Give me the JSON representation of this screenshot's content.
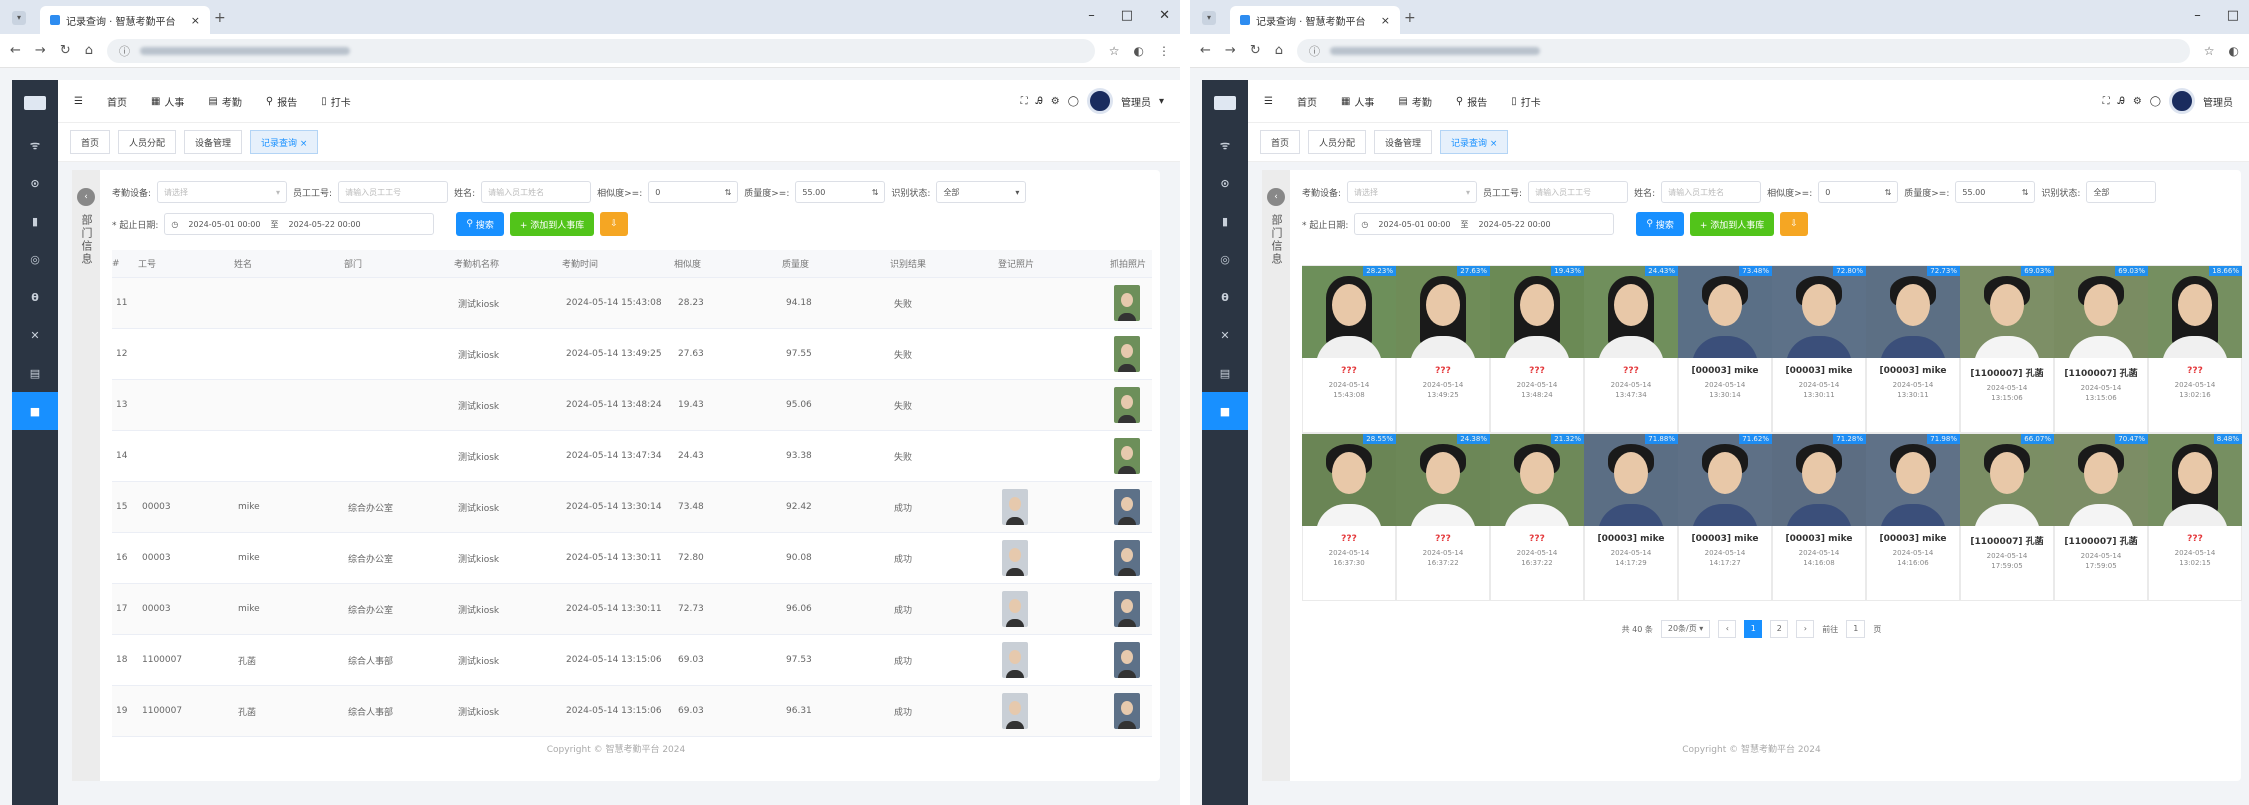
{
  "browser": {
    "tab_title": "记录查询 · 智慧考勤平台",
    "tab_close": "×",
    "new_tab": "+",
    "window_controls": [
      "–",
      "□",
      "✕"
    ]
  },
  "app": {
    "top_menu": [
      {
        "label": "首页",
        "icon": "home-icon"
      },
      {
        "label": "人事",
        "icon": "grid-icon"
      },
      {
        "label": "考勤",
        "icon": "calendar-icon"
      },
      {
        "label": "报告",
        "icon": "search-icon"
      },
      {
        "label": "打卡",
        "icon": "doc-icon"
      }
    ],
    "user_name": "管理员",
    "tags": [
      {
        "label": "首页"
      },
      {
        "label": "人员分配"
      },
      {
        "label": "设备管理"
      },
      {
        "label": "记录查询 ×",
        "active": true
      }
    ],
    "sidebar_glyphs": [
      "ᯤ",
      "⊙",
      "▮",
      "◎",
      "θ",
      "✕",
      "▤",
      "■"
    ],
    "dept_panel": {
      "toggle": "‹",
      "label": "部门信息"
    },
    "copyright": "Copyright © 智慧考勤平台 2024"
  },
  "left_window": {
    "filters": {
      "device_label": "考勤设备:",
      "device_placeholder": "请选择",
      "emp_id_label": "员工工号:",
      "emp_id_placeholder": "请输入员工工号",
      "name_label": "姓名:",
      "name_placeholder": "请输入员工姓名",
      "similarity_label": "相似度>=:",
      "similarity_value": "0",
      "quality_label": "质量度>=:",
      "quality_value": "55.00",
      "status_label": "识别状态:",
      "status_value": "全部",
      "date_label": "* 起止日期:",
      "date_start": "2024-05-01 00:00",
      "date_sep": "至",
      "date_end": "2024-05-22 00:00",
      "btn_search": "搜索",
      "btn_add": "+ 添加到人事库",
      "btn_export": "⇩"
    },
    "columns": [
      "#",
      "工号",
      "姓名",
      "部门",
      "考勤机名称",
      "考勤时间",
      "相似度",
      "质量度",
      "识别结果",
      "登记照片",
      "抓拍照片"
    ],
    "rows": [
      {
        "no": "11",
        "id": "",
        "name": "",
        "dept": "",
        "device": "测试kiosk",
        "time": "2024-05-14 15:43:08",
        "sim": "28.23",
        "qual": "94.18",
        "result": "失败",
        "reg": false
      },
      {
        "no": "12",
        "id": "",
        "name": "",
        "dept": "",
        "device": "测试kiosk",
        "time": "2024-05-14 13:49:25",
        "sim": "27.63",
        "qual": "97.55",
        "result": "失败",
        "reg": false
      },
      {
        "no": "13",
        "id": "",
        "name": "",
        "dept": "",
        "device": "测试kiosk",
        "time": "2024-05-14 13:48:24",
        "sim": "19.43",
        "qual": "95.06",
        "result": "失败",
        "reg": false
      },
      {
        "no": "14",
        "id": "",
        "name": "",
        "dept": "",
        "device": "测试kiosk",
        "time": "2024-05-14 13:47:34",
        "sim": "24.43",
        "qual": "93.38",
        "result": "失败",
        "reg": false
      },
      {
        "no": "15",
        "id": "00003",
        "name": "mike",
        "dept": "综合办公室",
        "device": "测试kiosk",
        "time": "2024-05-14 13:30:14",
        "sim": "73.48",
        "qual": "92.42",
        "result": "成功",
        "reg": true
      },
      {
        "no": "16",
        "id": "00003",
        "name": "mike",
        "dept": "综合办公室",
        "device": "测试kiosk",
        "time": "2024-05-14 13:30:11",
        "sim": "72.80",
        "qual": "90.08",
        "result": "成功",
        "reg": true
      },
      {
        "no": "17",
        "id": "00003",
        "name": "mike",
        "dept": "综合办公室",
        "device": "测试kiosk",
        "time": "2024-05-14 13:30:11",
        "sim": "72.73",
        "qual": "96.06",
        "result": "成功",
        "reg": true
      },
      {
        "no": "18",
        "id": "1100007",
        "name": "孔菡",
        "dept": "综合人事部",
        "device": "测试kiosk",
        "time": "2024-05-14 13:15:06",
        "sim": "69.03",
        "qual": "97.53",
        "result": "成功",
        "reg": true
      },
      {
        "no": "19",
        "id": "1100007",
        "name": "孔菡",
        "dept": "综合人事部",
        "device": "测试kiosk",
        "time": "2024-05-14 13:15:06",
        "sim": "69.03",
        "qual": "96.31",
        "result": "成功",
        "reg": true
      }
    ]
  },
  "right_window": {
    "filters": {
      "device_label": "考勤设备:",
      "device_placeholder": "请选择",
      "emp_id_label": "员工工号:",
      "emp_id_placeholder": "请输入员工工号",
      "name_label": "姓名:",
      "name_placeholder": "请输入员工姓名",
      "similarity_label": "相似度>=:",
      "similarity_value": "0",
      "quality_label": "质量度>=:",
      "quality_value": "55.00",
      "status_label": "识别状态:",
      "status_value": "全部",
      "date_label": "* 起止日期:",
      "date_start": "2024-05-01 00:00",
      "date_sep": "至",
      "date_end": "2024-05-22 00:00",
      "btn_search": "搜索",
      "btn_add": "+ 添加到人事库",
      "btn_export": "⇩"
    },
    "cards": [
      {
        "score": "28.23%",
        "name": "???",
        "date": "2024-05-14",
        "time": "15:43:08",
        "known": false,
        "gender": "f",
        "bg": "#6d8f5a",
        "shirt": "#f0f0f0"
      },
      {
        "score": "27.63%",
        "name": "???",
        "date": "2024-05-14",
        "time": "13:49:25",
        "known": false,
        "gender": "f",
        "bg": "#6f8c58",
        "shirt": "#f0f0f0"
      },
      {
        "score": "19.43%",
        "name": "???",
        "date": "2024-05-14",
        "time": "13:48:24",
        "known": false,
        "gender": "f",
        "bg": "#6b8a55",
        "shirt": "#f0f0f0"
      },
      {
        "score": "24.43%",
        "name": "???",
        "date": "2024-05-14",
        "time": "13:47:34",
        "known": false,
        "gender": "f",
        "bg": "#708f5c",
        "shirt": "#f0f0f0"
      },
      {
        "score": "73.48%",
        "name": "[00003] mike",
        "date": "2024-05-14",
        "time": "13:30:14",
        "known": true,
        "gender": "m",
        "bg": "#5a6f86",
        "shirt": "#3b4f7a"
      },
      {
        "score": "72.80%",
        "name": "[00003] mike",
        "date": "2024-05-14",
        "time": "13:30:11",
        "known": true,
        "gender": "m",
        "bg": "#5d7188",
        "shirt": "#3b4f7a"
      },
      {
        "score": "72.73%",
        "name": "[00003] mike",
        "date": "2024-05-14",
        "time": "13:30:11",
        "known": true,
        "gender": "m",
        "bg": "#5c6f84",
        "shirt": "#3b4f7a"
      },
      {
        "score": "69.03%",
        "name": "[1100007] 孔菡",
        "date": "2024-05-14",
        "time": "13:15:06",
        "known": true,
        "gender": "m",
        "bg": "#7d8f66",
        "shirt": "#f4f4f4"
      },
      {
        "score": "69.03%",
        "name": "[1100007] 孔菡",
        "date": "2024-05-14",
        "time": "13:15:06",
        "known": true,
        "gender": "m",
        "bg": "#7a8c62",
        "shirt": "#f4f4f4"
      },
      {
        "score": "18.66%",
        "name": "???",
        "date": "2024-05-14",
        "time": "13:02:16",
        "known": false,
        "gender": "f",
        "bg": "#758f60",
        "shirt": "#f0f0f0"
      },
      {
        "score": "28.55%",
        "name": "???",
        "date": "2024-05-14",
        "time": "16:37:30",
        "known": false,
        "gender": "m",
        "bg": "#6a8555",
        "shirt": "#f4f4f4"
      },
      {
        "score": "24.38%",
        "name": "???",
        "date": "2024-05-14",
        "time": "16:37:22",
        "known": false,
        "gender": "m",
        "bg": "#6c8757",
        "shirt": "#f4f4f4"
      },
      {
        "score": "21.32%",
        "name": "???",
        "date": "2024-05-14",
        "time": "16:37:22",
        "known": false,
        "gender": "m",
        "bg": "#6e8959",
        "shirt": "#f4f4f4"
      },
      {
        "score": "71.88%",
        "name": "[00003] mike",
        "date": "2024-05-14",
        "time": "14:17:29",
        "known": true,
        "gender": "m",
        "bg": "#5b6e84",
        "shirt": "#3b4f7a"
      },
      {
        "score": "71.62%",
        "name": "[00003] mike",
        "date": "2024-05-14",
        "time": "14:17:27",
        "known": true,
        "gender": "m",
        "bg": "#5e7086",
        "shirt": "#3b4f7a"
      },
      {
        "score": "71.28%",
        "name": "[00003] mike",
        "date": "2024-05-14",
        "time": "14:16:08",
        "known": true,
        "gender": "m",
        "bg": "#5c6d82",
        "shirt": "#3b4f7a"
      },
      {
        "score": "71.98%",
        "name": "[00003] mike",
        "date": "2024-05-14",
        "time": "14:16:06",
        "known": true,
        "gender": "m",
        "bg": "#5f7187",
        "shirt": "#3b4f7a"
      },
      {
        "score": "66.07%",
        "name": "[1100007] 孔菡",
        "date": "2024-05-14",
        "time": "17:59:05",
        "known": true,
        "gender": "m",
        "bg": "#7b8e64",
        "shirt": "#f4f4f4"
      },
      {
        "score": "70.47%",
        "name": "[1100007] 孔菡",
        "date": "2024-05-14",
        "time": "17:59:05",
        "known": true,
        "gender": "m",
        "bg": "#7c8d65",
        "shirt": "#f4f4f4"
      },
      {
        "score": "8.48%",
        "name": "???",
        "date": "2024-05-14",
        "time": "13:02:15",
        "known": false,
        "gender": "f",
        "bg": "#768f61",
        "shirt": "#f0f0f0"
      }
    ],
    "pager": {
      "total": "共 40 条",
      "page_size": "20条/页",
      "prev": "‹",
      "pages": [
        "1",
        "2"
      ],
      "next": "›",
      "goto_label": "前往",
      "goto_value": "1",
      "goto_suffix": "页"
    }
  }
}
